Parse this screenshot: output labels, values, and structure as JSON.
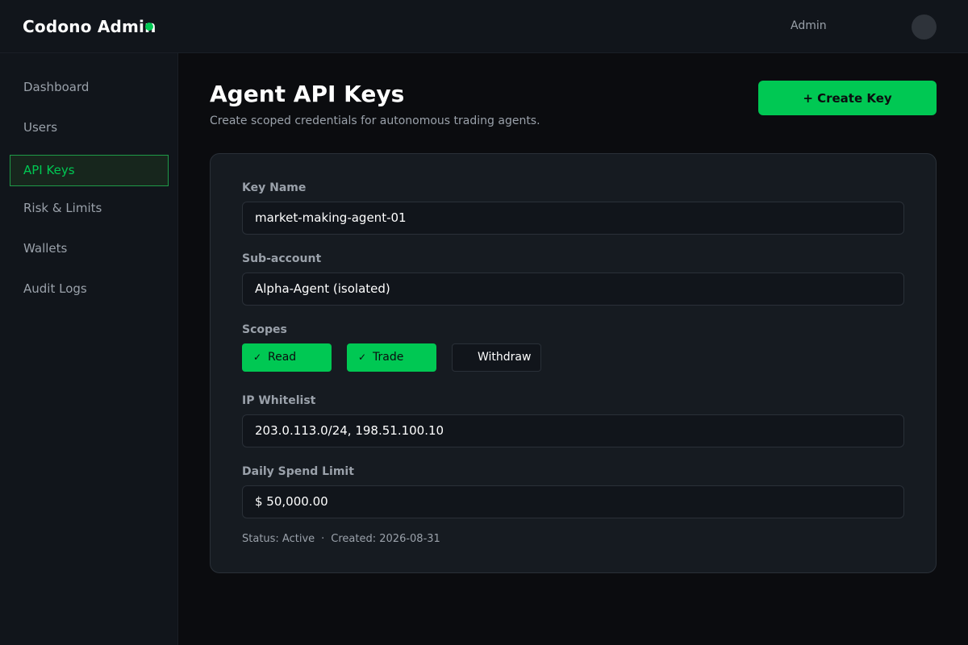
{
  "header": {
    "brand": "Codono Admin",
    "user_label": "Admin",
    "accent_color": "#00c853"
  },
  "sidebar": {
    "items": [
      {
        "label": "Dashboard",
        "active": false
      },
      {
        "label": "Users",
        "active": false
      },
      {
        "label": "API Keys",
        "active": true
      },
      {
        "label": "Risk & Limits",
        "active": false
      },
      {
        "label": "Wallets",
        "active": false
      },
      {
        "label": "Audit Logs",
        "active": false
      }
    ]
  },
  "page": {
    "title": "Agent API Keys",
    "subtitle": "Create scoped credentials for autonomous trading agents.",
    "create_button": "+ Create Key"
  },
  "form": {
    "key_name": {
      "label": "Key Name",
      "value": "market-making-agent-01"
    },
    "sub_account": {
      "label": "Sub-account",
      "value": "Alpha-Agent (isolated)"
    },
    "scopes": {
      "label": "Scopes",
      "options": [
        {
          "label": "Read",
          "checked": true,
          "check_icon": "✓"
        },
        {
          "label": "Trade",
          "checked": true,
          "check_icon": "✓"
        },
        {
          "label": "Withdraw",
          "checked": false,
          "check_icon": ""
        }
      ]
    },
    "ip_whitelist": {
      "label": "IP Whitelist",
      "value": "203.0.113.0/24, 198.51.100.10"
    },
    "daily_spend_limit": {
      "label": "Daily Spend Limit",
      "value": "$ 50,000.00"
    }
  },
  "meta": {
    "status": "Status: Active",
    "separator": "·",
    "created": "Created: 2026-08-31"
  }
}
